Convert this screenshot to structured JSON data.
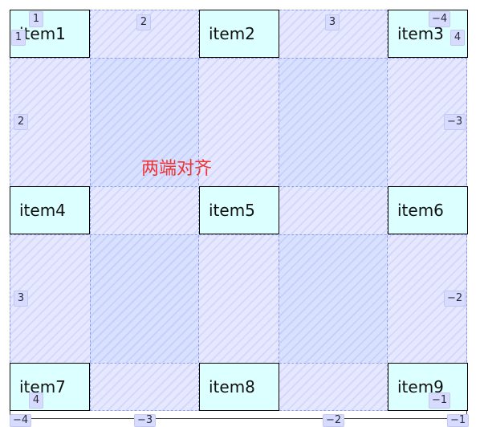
{
  "grid": {
    "items": [
      {
        "label": "item1"
      },
      {
        "label": "item2"
      },
      {
        "label": "item3"
      },
      {
        "label": "item4"
      },
      {
        "label": "item5"
      },
      {
        "label": "item6"
      },
      {
        "label": "item7"
      },
      {
        "label": "item8"
      },
      {
        "label": "item9"
      }
    ],
    "center_label": "两端对齐"
  },
  "line_numbers": {
    "top": [
      "1",
      "2",
      "3",
      "-4"
    ],
    "left": [
      "1",
      "2",
      "3",
      "4"
    ],
    "right": [
      "4",
      "-3",
      "-2",
      "-1"
    ],
    "bottom": [
      "-4",
      "-3",
      "-2",
      "-1"
    ]
  },
  "colors": {
    "item_background": "#dcffff",
    "item_border": "#000000",
    "label_color": "#ee3333",
    "badge_background": "#d7dcff",
    "gap_background": "#e2e4ff"
  }
}
